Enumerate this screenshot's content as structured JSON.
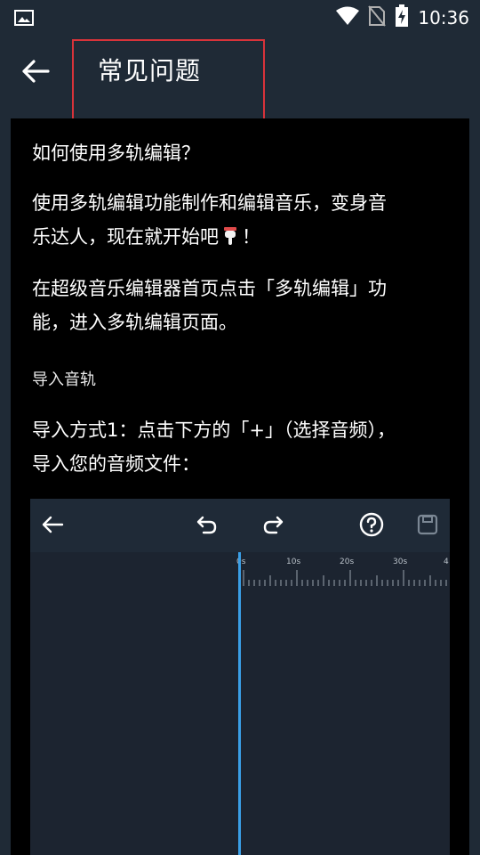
{
  "status_bar": {
    "time": "10:36",
    "icons": [
      "image-icon",
      "wifi-icon",
      "no-sim-icon",
      "battery-charging-icon"
    ]
  },
  "app_bar": {
    "title": "常见问题",
    "back_icon": "arrow-left-icon"
  },
  "content": {
    "question": "如何使用多轨编辑？",
    "intro_line1": "使用多轨编辑功能制作和编辑音乐，变身音",
    "intro_line2_before_emoji": "乐达人，现在就开始吧",
    "intro_line2_after_emoji": "！",
    "emoji_icon": "pointing-hand-icon",
    "step_line1": "在超级音乐编辑器首页点击「多轨编辑」功",
    "step_line2": "能，进入多轨编辑页面。",
    "section_heading": "导入音轨",
    "import_line1": "导入方式1：点击下方的「+」（选择音频），",
    "import_line2": "导入您的音频文件："
  },
  "editor_screenshot": {
    "toolbar_icons": [
      "arrow-left-icon",
      "undo-icon",
      "redo-icon",
      "help-icon",
      "save-icon"
    ],
    "ruler_labels": [
      "0s",
      "10s",
      "20s",
      "30s",
      "4"
    ],
    "colors": {
      "playhead": "#3a9fe6",
      "background": "#1c2430"
    }
  },
  "colors": {
    "app_bar_bg": "#1f2a36",
    "content_bg": "#000000",
    "highlight_border": "#d8333a"
  }
}
